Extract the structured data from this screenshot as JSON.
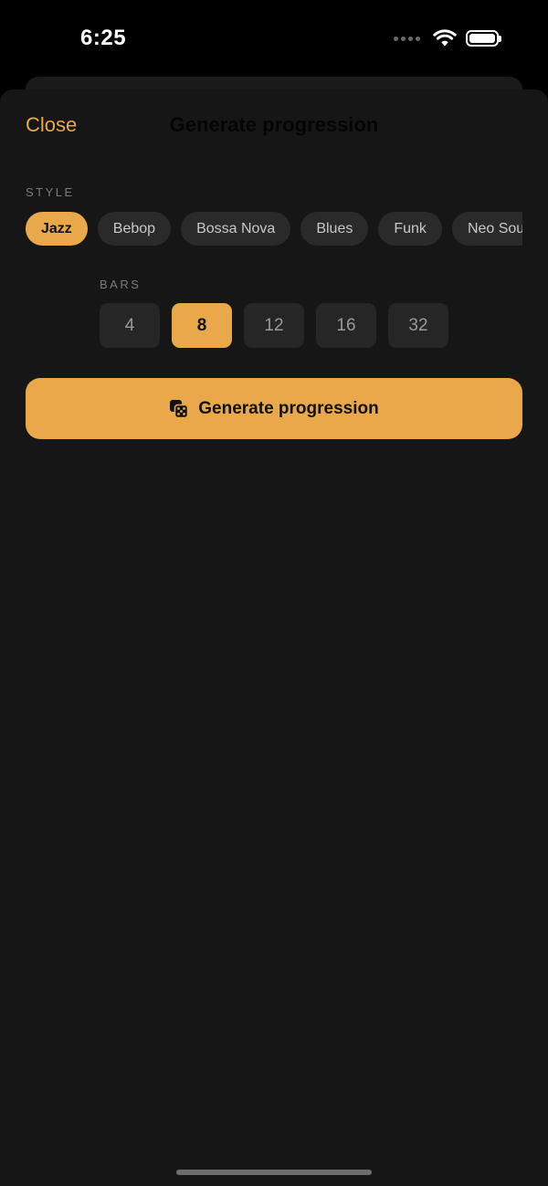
{
  "status_bar": {
    "time": "6:25"
  },
  "nav": {
    "close_label": "Close",
    "title": "Generate progression"
  },
  "style_section": {
    "label": "STYLE",
    "options": [
      "Jazz",
      "Bebop",
      "Bossa Nova",
      "Blues",
      "Funk",
      "Neo Soul"
    ],
    "selected": "Jazz"
  },
  "bars_section": {
    "label": "BARS",
    "options": [
      "4",
      "8",
      "12",
      "16",
      "32"
    ],
    "selected": "8"
  },
  "generate_button": {
    "label": "Generate progression",
    "icon": "dice-icon"
  },
  "colors": {
    "accent": "#e9a84a",
    "background": "#161616",
    "chip": "#2a2a2a"
  }
}
